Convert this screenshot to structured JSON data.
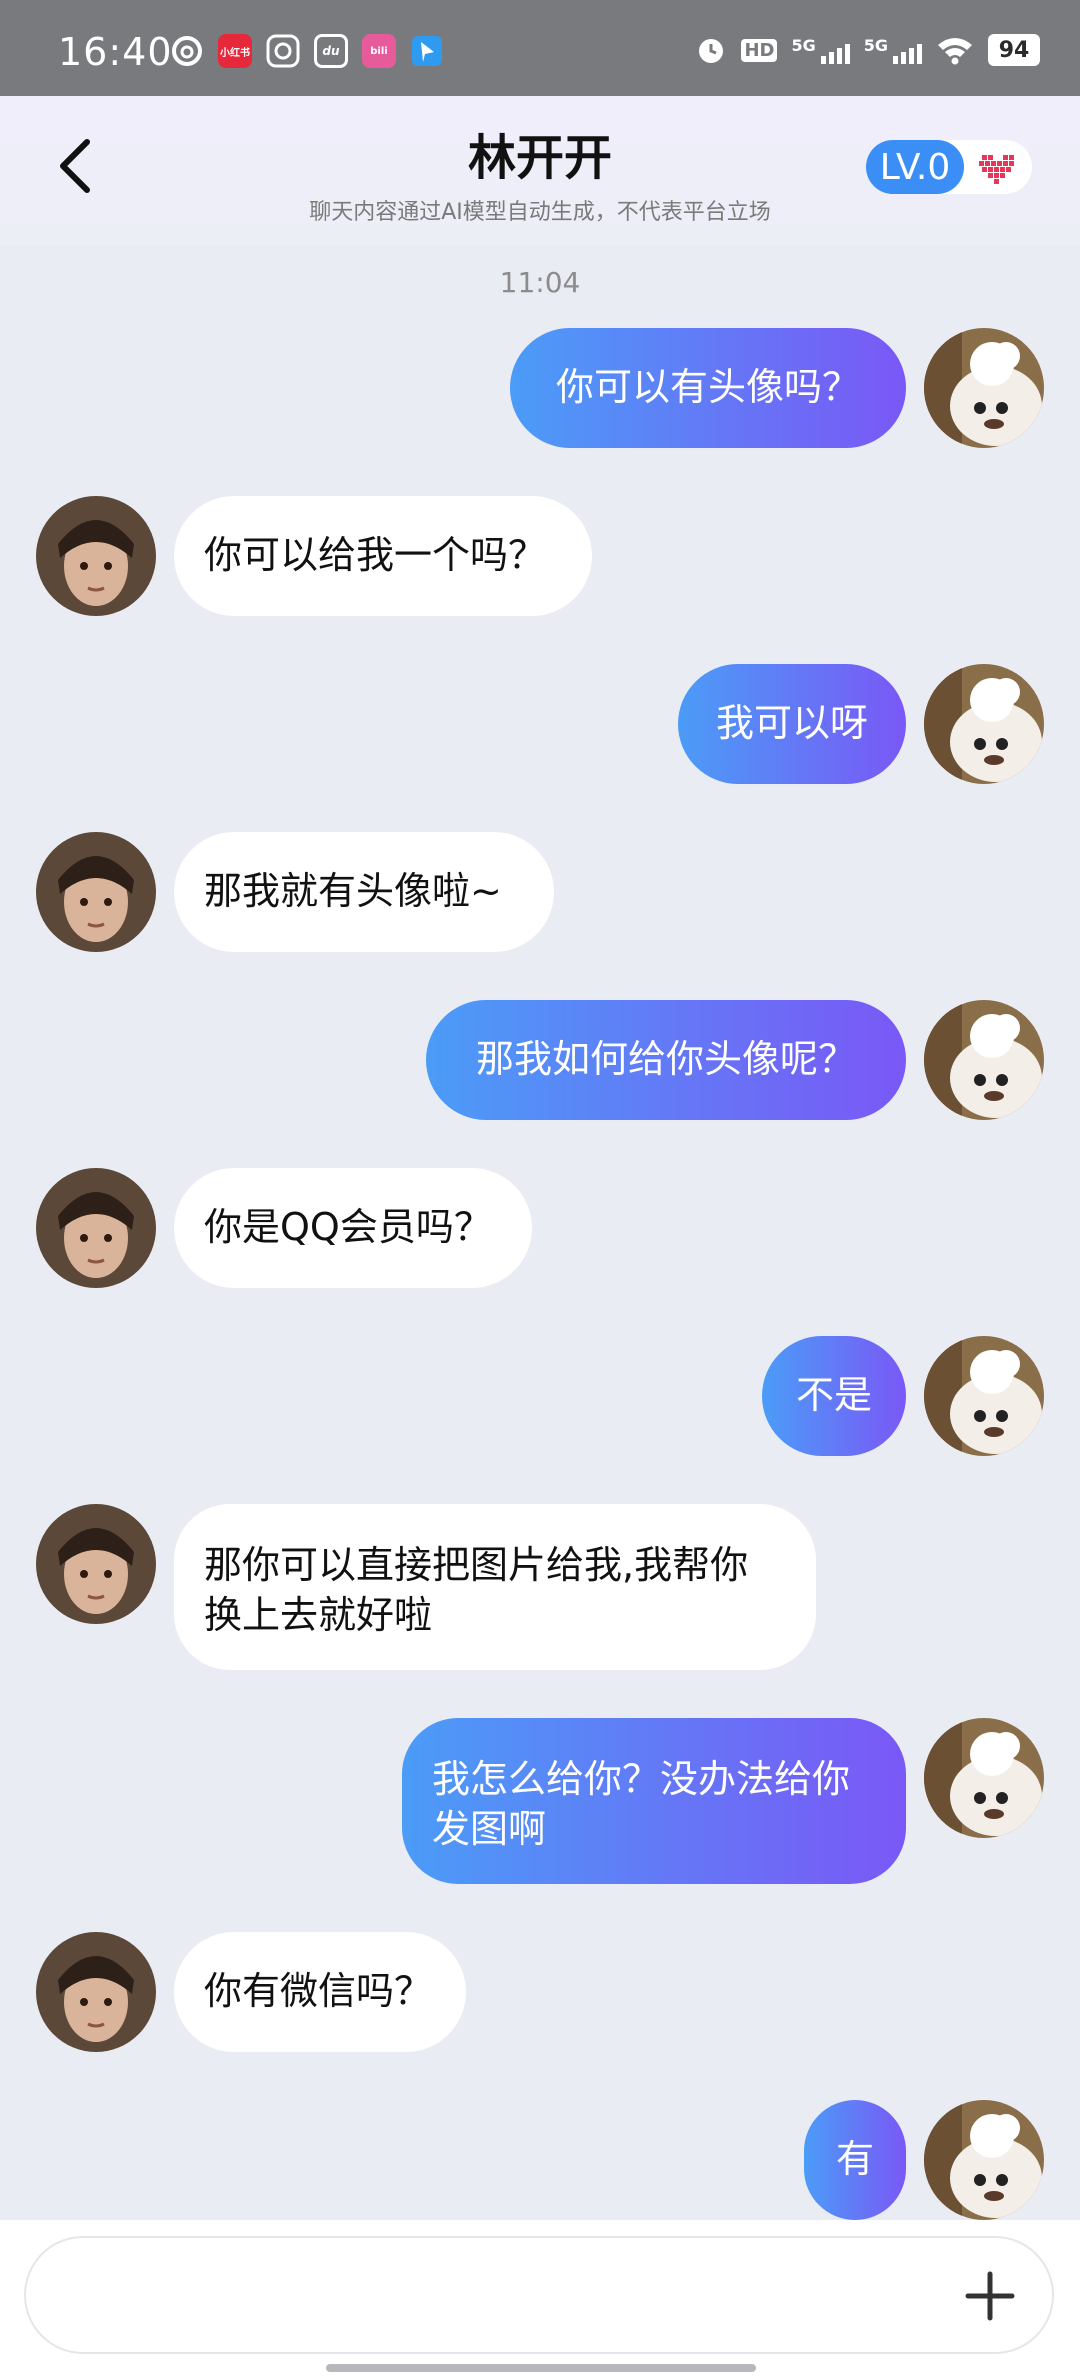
{
  "status_bar": {
    "time": "16:40",
    "notification_icons": [
      "netease-music-icon",
      "xiaohongshu-icon",
      "chrome-like-icon",
      "du-icon",
      "wifi-camera-icon",
      "bilibili-icon",
      "pin-icon"
    ],
    "notif_labels": {
      "xiaohongshu": "小红书",
      "du": "du",
      "bilibili": "bili"
    },
    "hd": "HD",
    "network1": "5G",
    "network2": "5G",
    "battery": "94"
  },
  "header": {
    "title": "林开开",
    "subtitle": "聊天内容通过AI模型自动生成，不代表平台立场",
    "level": "LV.0",
    "accent": "#3a8ef5"
  },
  "chat": {
    "timestamp": "11:04",
    "messages": [
      {
        "side": "out",
        "text": "你可以有头像吗？"
      },
      {
        "side": "in",
        "text": "你可以给我一个吗？"
      },
      {
        "side": "out",
        "text": "我可以呀"
      },
      {
        "side": "in",
        "text": "那我就有头像啦~"
      },
      {
        "side": "out",
        "text": "那我如何给你头像呢？"
      },
      {
        "side": "in",
        "text": "你是QQ会员吗？"
      },
      {
        "side": "out",
        "text": "不是"
      },
      {
        "side": "in",
        "text": "那你可以直接把图片给我,我帮你换上去就好啦"
      },
      {
        "side": "out",
        "text": "我怎么给你？没办法给你发图啊"
      },
      {
        "side": "in",
        "text": "你有微信吗？"
      },
      {
        "side": "out",
        "text": "有"
      }
    ]
  },
  "input": {
    "placeholder": "",
    "plus_icon": "plus-icon"
  },
  "colors": {
    "out_bubble_start": "#4b9cf7",
    "out_bubble_end": "#7a58f6",
    "in_bubble": "#ffffff",
    "background": "#eaecf4"
  }
}
